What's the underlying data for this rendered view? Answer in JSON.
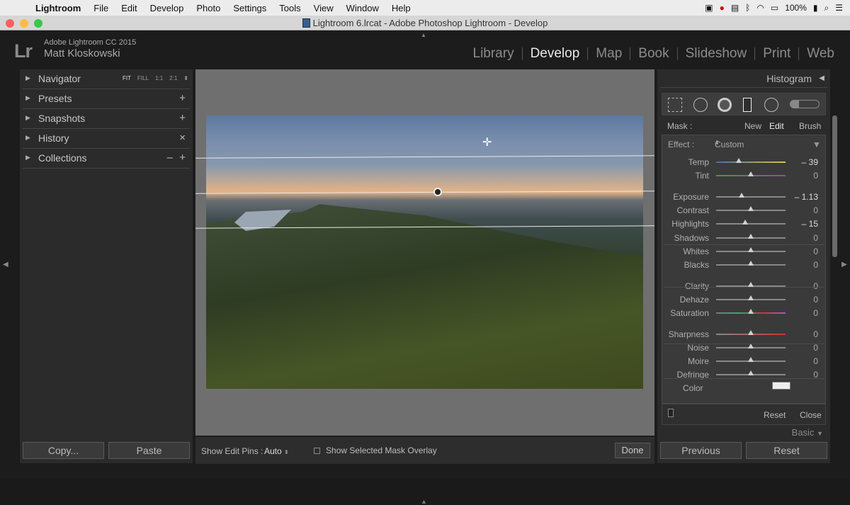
{
  "menubar": {
    "app": "Lightroom",
    "items": [
      "File",
      "Edit",
      "Develop",
      "Photo",
      "Settings",
      "Tools",
      "View",
      "Window",
      "Help"
    ],
    "battery": "100%"
  },
  "window": {
    "title": "Lightroom 6.lrcat - Adobe Photoshop Lightroom - Develop"
  },
  "identity": {
    "logo": "Lr",
    "app": "Adobe Lightroom CC 2015",
    "user": "Matt Kloskowski"
  },
  "modules": [
    "Library",
    "Develop",
    "Map",
    "Book",
    "Slideshow",
    "Print",
    "Web"
  ],
  "active_module": "Develop",
  "left_panel": {
    "navigator": {
      "label": "Navigator",
      "zoom_options": [
        "FIT",
        "FILL",
        "1:1",
        "2:1"
      ]
    },
    "presets": {
      "label": "Presets",
      "action": "+"
    },
    "snapshots": {
      "label": "Snapshots",
      "action": "+"
    },
    "history": {
      "label": "History",
      "action": "×"
    },
    "collections": {
      "label": "Collections",
      "action_minus": "–",
      "action_plus": "+"
    },
    "copy_label": "Copy...",
    "paste_label": "Paste"
  },
  "toolbar": {
    "pins_label": "Show Edit Pins :",
    "pins_value": "Auto",
    "overlay_label": "Show Selected Mask Overlay",
    "done_label": "Done"
  },
  "right_panel": {
    "histogram": "Histogram",
    "mask": {
      "label": "Mask :",
      "new": "New",
      "edit": "Edit",
      "brush": "Brush"
    },
    "effect": {
      "label": "Effect :",
      "value": "Custom"
    },
    "sliders": [
      {
        "name": "Temp",
        "value": "– 39",
        "pos": 0.33
      },
      {
        "name": "Tint",
        "value": "0",
        "pos": 0.5
      },
      {
        "name": "Exposure",
        "value": "– 1.13",
        "pos": 0.37
      },
      {
        "name": "Contrast",
        "value": "0",
        "pos": 0.5
      },
      {
        "name": "Highlights",
        "value": "– 15",
        "pos": 0.42
      },
      {
        "name": "Shadows",
        "value": "0",
        "pos": 0.5
      },
      {
        "name": "Whites",
        "value": "0",
        "pos": 0.5
      },
      {
        "name": "Blacks",
        "value": "0",
        "pos": 0.5
      },
      {
        "name": "Clarity",
        "value": "0",
        "pos": 0.5
      },
      {
        "name": "Dehaze",
        "value": "0",
        "pos": 0.5
      },
      {
        "name": "Saturation",
        "value": "0",
        "pos": 0.5
      },
      {
        "name": "Sharpness",
        "value": "0",
        "pos": 0.5
      },
      {
        "name": "Noise",
        "value": "0",
        "pos": 0.5
      },
      {
        "name": "Moire",
        "value": "0",
        "pos": 0.5
      },
      {
        "name": "Defringe",
        "value": "0",
        "pos": 0.5
      }
    ],
    "color_label": "Color",
    "reset_label": "Reset",
    "close_label": "Close",
    "basic_label": "Basic",
    "previous_label": "Previous",
    "reset_button_label": "Reset"
  }
}
